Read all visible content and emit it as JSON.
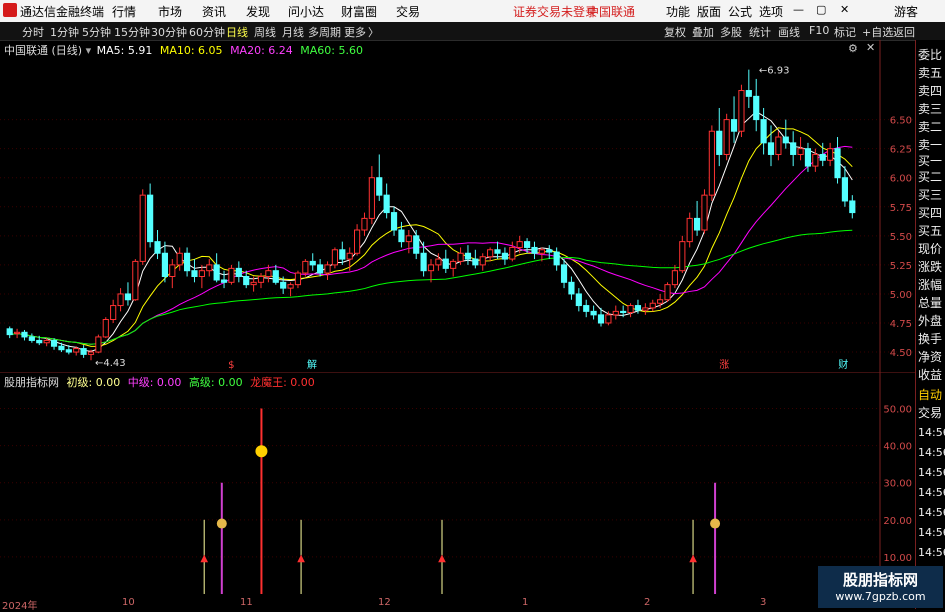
{
  "app": {
    "title": "通达信金融终端",
    "menu": [
      "行情",
      "市场",
      "资讯",
      "发现",
      "问小达",
      "财富圈",
      "交易"
    ],
    "login_status": "证券交易未登录",
    "broker": "中国联通",
    "right_menu": [
      "功能",
      "版面",
      "公式",
      "选项"
    ],
    "guest": "游客"
  },
  "toolbar": {
    "periods": [
      "分时",
      "1分钟",
      "5分钟",
      "15分钟",
      "30分钟",
      "60分钟",
      "日线",
      "周线",
      "月线",
      "多周期",
      "更多"
    ],
    "active_period": "日线",
    "more_arrow": "〉",
    "right_buttons": [
      "复权",
      "叠加",
      "多股",
      "统计",
      "画线",
      "F10",
      "标记",
      "+自选",
      "返回"
    ]
  },
  "main_chart": {
    "stock_name": "中国联通",
    "period_label": "(日线)",
    "indicators": [
      {
        "label": "MA5: 5.91",
        "color": "#ffffff"
      },
      {
        "label": "MA10: 6.05",
        "color": "#ffff00"
      },
      {
        "label": "MA20: 6.24",
        "color": "#ff00ff"
      },
      {
        "label": "MA60: 5.60",
        "color": "#00ff00"
      }
    ],
    "high_label": "6.93",
    "low_label": "4.43",
    "event_markers": [
      "$",
      "解",
      "涨",
      "财"
    ],
    "colors": {
      "up": "#ff3232",
      "down": "#54ffff",
      "ma5": "#ffffff",
      "ma10": "#ffff00",
      "ma20": "#ff00ff",
      "ma60": "#00ff00"
    }
  },
  "sub_chart": {
    "name": "股朋指标网",
    "values": [
      {
        "label": "初级: 0.00",
        "color": "#ffff8f"
      },
      {
        "label": "中级: 0.00",
        "color": "#ff40ff"
      },
      {
        "label": "高级: 0.00",
        "color": "#40ff40"
      },
      {
        "label": "龙魔王: 0.00",
        "color": "#ff3030"
      }
    ],
    "y_ticks": [
      "50.00",
      "40.00",
      "30.00",
      "20.00",
      "10.00"
    ],
    "signals": {
      "yellow": [
        "2024-10-17",
        "2024-11-08",
        "2024-12-10",
        "2025-02-05"
      ],
      "magenta": [
        "2024-10-21",
        "2025-02-10"
      ],
      "red_tall": [
        "2024-10-30"
      ]
    }
  },
  "chart_data": {
    "type": "candlestick",
    "title": "中国联通 (日线)",
    "y_ticks": [
      6.5,
      6.25,
      6.0,
      5.75,
      5.5,
      5.25,
      5.0,
      4.75,
      4.5
    ],
    "ylim": [
      4.38,
      7.03
    ],
    "x_ticks": [
      "2024年",
      "10",
      "11",
      "12",
      "1",
      "2",
      "3"
    ],
    "ohlc": [
      [
        4.7,
        4.72,
        4.62,
        4.65
      ],
      [
        4.66,
        4.7,
        4.62,
        4.67
      ],
      [
        4.67,
        4.69,
        4.6,
        4.63
      ],
      [
        4.63,
        4.66,
        4.58,
        4.6
      ],
      [
        4.6,
        4.64,
        4.56,
        4.58
      ],
      [
        4.58,
        4.62,
        4.55,
        4.6
      ],
      [
        4.6,
        4.62,
        4.52,
        4.55
      ],
      [
        4.55,
        4.58,
        4.5,
        4.52
      ],
      [
        4.52,
        4.56,
        4.48,
        4.5
      ],
      [
        4.5,
        4.55,
        4.47,
        4.53
      ],
      [
        4.53,
        4.56,
        4.45,
        4.48
      ],
      [
        4.48,
        4.52,
        4.43,
        4.5
      ],
      [
        4.5,
        4.65,
        4.49,
        4.63
      ],
      [
        4.63,
        4.8,
        4.62,
        4.78
      ],
      [
        4.78,
        4.95,
        4.75,
        4.9
      ],
      [
        4.9,
        5.05,
        4.85,
        5.0
      ],
      [
        5.0,
        5.1,
        4.9,
        4.95
      ],
      [
        4.95,
        5.3,
        4.94,
        5.28
      ],
      [
        5.28,
        5.9,
        5.25,
        5.85
      ],
      [
        5.85,
        5.95,
        5.4,
        5.45
      ],
      [
        5.45,
        5.55,
        5.3,
        5.35
      ],
      [
        5.35,
        5.45,
        5.1,
        5.15
      ],
      [
        5.15,
        5.3,
        5.05,
        5.25
      ],
      [
        5.25,
        5.4,
        5.2,
        5.35
      ],
      [
        5.35,
        5.4,
        5.15,
        5.2
      ],
      [
        5.2,
        5.3,
        5.1,
        5.15
      ],
      [
        5.15,
        5.25,
        5.05,
        5.2
      ],
      [
        5.2,
        5.3,
        5.15,
        5.25
      ],
      [
        5.25,
        5.35,
        5.1,
        5.12
      ],
      [
        5.12,
        5.2,
        5.05,
        5.1
      ],
      [
        5.1,
        5.25,
        5.08,
        5.22
      ],
      [
        5.22,
        5.28,
        5.1,
        5.15
      ],
      [
        5.15,
        5.2,
        5.05,
        5.08
      ],
      [
        5.08,
        5.15,
        5.02,
        5.1
      ],
      [
        5.1,
        5.18,
        5.05,
        5.15
      ],
      [
        5.15,
        5.25,
        5.1,
        5.2
      ],
      [
        5.2,
        5.25,
        5.08,
        5.1
      ],
      [
        5.1,
        5.15,
        5.0,
        5.05
      ],
      [
        5.05,
        5.1,
        4.98,
        5.08
      ],
      [
        5.08,
        5.2,
        5.05,
        5.18
      ],
      [
        5.18,
        5.3,
        5.15,
        5.28
      ],
      [
        5.28,
        5.35,
        5.2,
        5.25
      ],
      [
        5.25,
        5.3,
        5.15,
        5.18
      ],
      [
        5.18,
        5.28,
        5.12,
        5.25
      ],
      [
        5.25,
        5.4,
        5.22,
        5.38
      ],
      [
        5.38,
        5.45,
        5.25,
        5.3
      ],
      [
        5.3,
        5.4,
        5.2,
        5.35
      ],
      [
        5.35,
        5.6,
        5.33,
        5.55
      ],
      [
        5.55,
        5.7,
        5.5,
        5.65
      ],
      [
        5.65,
        6.1,
        5.6,
        6.0
      ],
      [
        6.0,
        6.2,
        5.8,
        5.85
      ],
      [
        5.85,
        5.95,
        5.65,
        5.7
      ],
      [
        5.7,
        5.75,
        5.5,
        5.55
      ],
      [
        5.55,
        5.62,
        5.4,
        5.45
      ],
      [
        5.45,
        5.55,
        5.35,
        5.5
      ],
      [
        5.5,
        5.55,
        5.3,
        5.35
      ],
      [
        5.35,
        5.45,
        5.15,
        5.2
      ],
      [
        5.2,
        5.3,
        5.1,
        5.25
      ],
      [
        5.25,
        5.35,
        5.2,
        5.3
      ],
      [
        5.3,
        5.38,
        5.18,
        5.22
      ],
      [
        5.22,
        5.3,
        5.15,
        5.28
      ],
      [
        5.28,
        5.4,
        5.25,
        5.35
      ],
      [
        5.35,
        5.42,
        5.25,
        5.3
      ],
      [
        5.3,
        5.38,
        5.22,
        5.25
      ],
      [
        5.25,
        5.35,
        5.2,
        5.32
      ],
      [
        5.32,
        5.4,
        5.28,
        5.38
      ],
      [
        5.38,
        5.45,
        5.3,
        5.35
      ],
      [
        5.35,
        5.4,
        5.25,
        5.3
      ],
      [
        5.3,
        5.45,
        5.28,
        5.4
      ],
      [
        5.4,
        5.5,
        5.35,
        5.45
      ],
      [
        5.45,
        5.48,
        5.35,
        5.4
      ],
      [
        5.4,
        5.45,
        5.3,
        5.35
      ],
      [
        5.35,
        5.4,
        5.28,
        5.38
      ],
      [
        5.38,
        5.42,
        5.3,
        5.36
      ],
      [
        5.36,
        5.4,
        5.2,
        5.25
      ],
      [
        5.25,
        5.3,
        5.05,
        5.1
      ],
      [
        5.1,
        5.15,
        4.95,
        5.0
      ],
      [
        5.0,
        5.05,
        4.85,
        4.9
      ],
      [
        4.9,
        4.95,
        4.8,
        4.85
      ],
      [
        4.85,
        4.9,
        4.78,
        4.82
      ],
      [
        4.82,
        4.88,
        4.72,
        4.75
      ],
      [
        4.75,
        4.85,
        4.73,
        4.82
      ],
      [
        4.82,
        4.9,
        4.78,
        4.85
      ],
      [
        4.85,
        4.9,
        4.8,
        4.84
      ],
      [
        4.84,
        4.92,
        4.8,
        4.9
      ],
      [
        4.9,
        4.95,
        4.83,
        4.86
      ],
      [
        4.86,
        4.92,
        4.82,
        4.88
      ],
      [
        4.88,
        4.95,
        4.85,
        4.92
      ],
      [
        4.92,
        5.0,
        4.88,
        4.95
      ],
      [
        4.95,
        5.1,
        4.93,
        5.08
      ],
      [
        5.08,
        5.25,
        5.05,
        5.2
      ],
      [
        5.2,
        5.5,
        5.18,
        5.45
      ],
      [
        5.45,
        5.7,
        5.4,
        5.65
      ],
      [
        5.65,
        5.8,
        5.5,
        5.55
      ],
      [
        5.55,
        5.9,
        5.52,
        5.85
      ],
      [
        5.85,
        6.45,
        5.8,
        6.4
      ],
      [
        6.4,
        6.6,
        6.1,
        6.2
      ],
      [
        6.2,
        6.55,
        6.15,
        6.5
      ],
      [
        6.5,
        6.7,
        6.3,
        6.4
      ],
      [
        6.4,
        6.8,
        6.35,
        6.75
      ],
      [
        6.75,
        6.93,
        6.6,
        6.7
      ],
      [
        6.7,
        6.85,
        6.4,
        6.5
      ],
      [
        6.5,
        6.6,
        6.2,
        6.3
      ],
      [
        6.3,
        6.45,
        6.1,
        6.2
      ],
      [
        6.2,
        6.4,
        6.15,
        6.35
      ],
      [
        6.35,
        6.5,
        6.25,
        6.3
      ],
      [
        6.3,
        6.4,
        6.1,
        6.2
      ],
      [
        6.2,
        6.35,
        6.15,
        6.25
      ],
      [
        6.25,
        6.3,
        6.05,
        6.1
      ],
      [
        6.1,
        6.25,
        6.05,
        6.2
      ],
      [
        6.2,
        6.3,
        6.1,
        6.15
      ],
      [
        6.15,
        6.3,
        6.1,
        6.25
      ],
      [
        6.25,
        6.35,
        5.95,
        6.0
      ],
      [
        6.0,
        6.1,
        5.75,
        5.8
      ],
      [
        5.8,
        5.85,
        5.65,
        5.7
      ]
    ]
  }
}
